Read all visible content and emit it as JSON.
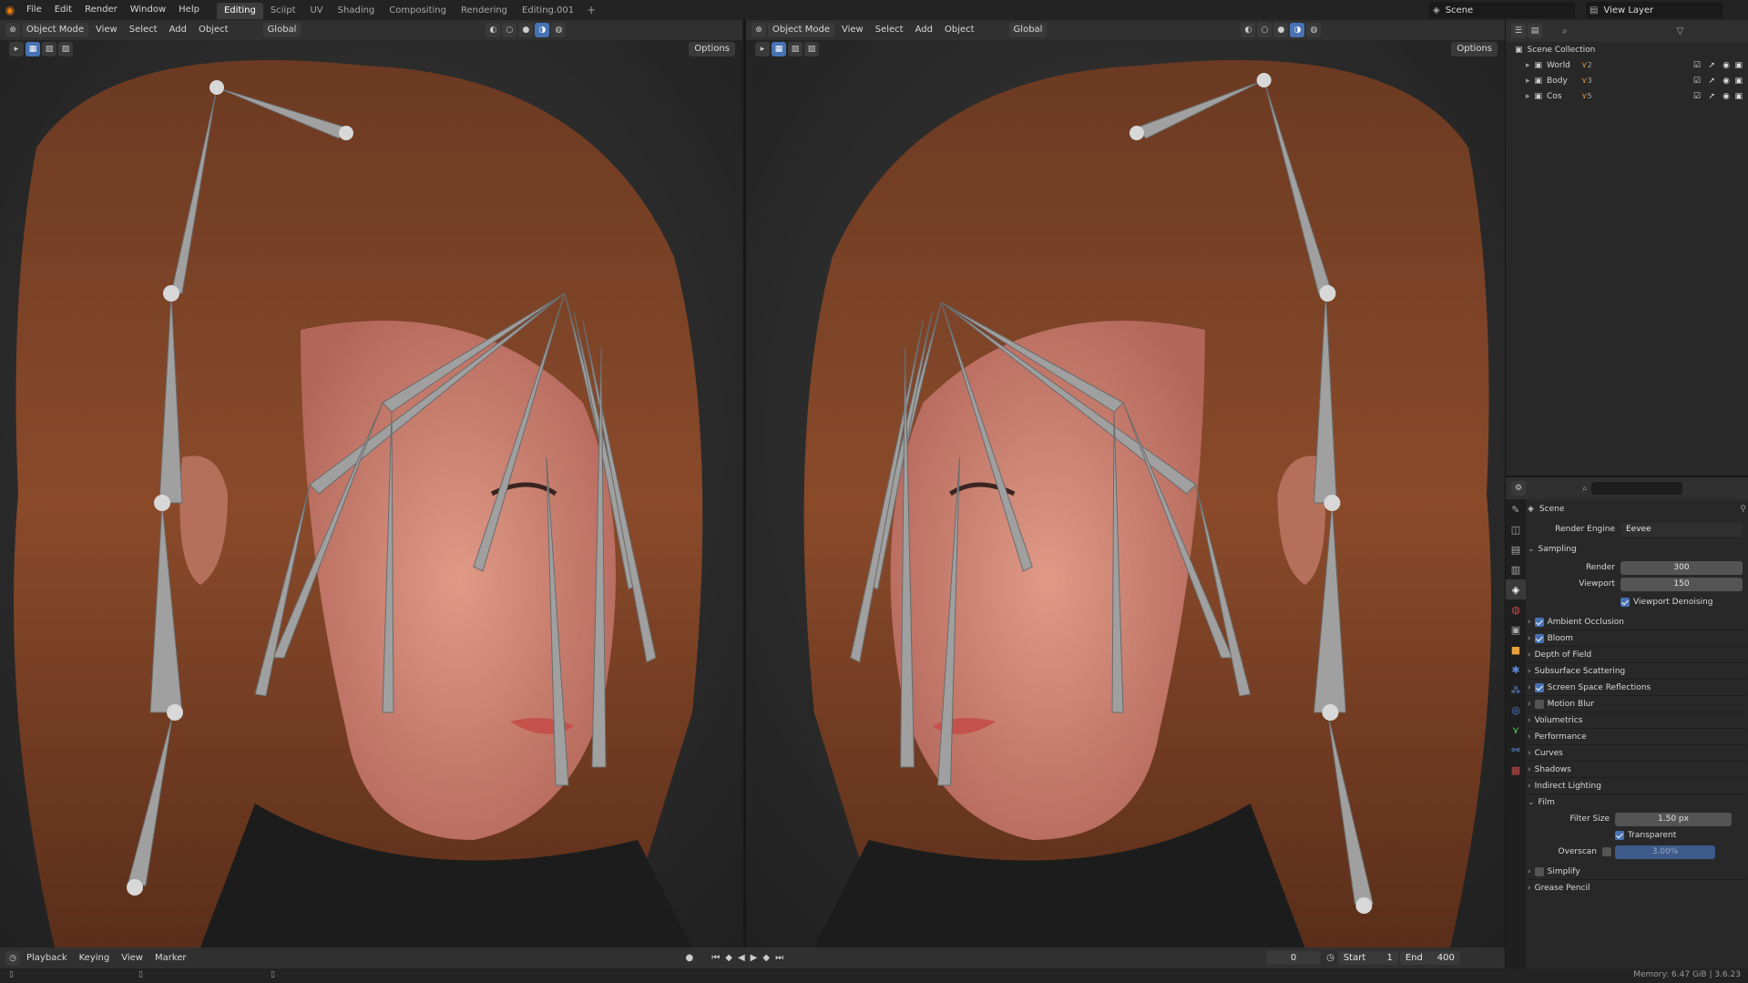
{
  "menus": [
    "File",
    "Edit",
    "Render",
    "Window",
    "Help"
  ],
  "workspaces": [
    {
      "label": "Editing",
      "active": true
    },
    {
      "label": "Sciipt",
      "active": false
    },
    {
      "label": "UV",
      "active": false
    },
    {
      "label": "Shading",
      "active": false
    },
    {
      "label": "Compositing",
      "active": false
    },
    {
      "label": "Rendering",
      "active": false
    },
    {
      "label": "Editing.001",
      "active": false
    }
  ],
  "scene_name": "Scene",
  "view_layer": "View Layer",
  "viewport": {
    "mode": "Object Mode",
    "menus": [
      "View",
      "Select",
      "Add",
      "Object"
    ],
    "transform": "Global",
    "options_label": "Options"
  },
  "outliner": {
    "collection": "Scene Collection",
    "items": [
      {
        "name": "World",
        "count": "2"
      },
      {
        "name": "Body",
        "count": "3"
      },
      {
        "name": "Cos",
        "count": "5"
      }
    ]
  },
  "properties": {
    "context": "Scene",
    "render_engine_label": "Render Engine",
    "render_engine": "Eevee",
    "sampling": {
      "header": "Sampling",
      "render_label": "Render",
      "render": "300",
      "viewport_label": "Viewport",
      "viewport": "150",
      "denoise": "Viewport Denoising"
    },
    "panels": [
      {
        "label": "Ambient Occlusion",
        "checkbox": true,
        "checked": true
      },
      {
        "label": "Bloom",
        "checkbox": true,
        "checked": true
      },
      {
        "label": "Depth of Field",
        "checkbox": false
      },
      {
        "label": "Subsurface Scattering",
        "checkbox": false
      },
      {
        "label": "Screen Space Reflections",
        "checkbox": true,
        "checked": true
      },
      {
        "label": "Motion Blur",
        "checkbox": true,
        "checked": false
      },
      {
        "label": "Volumetrics",
        "checkbox": false
      },
      {
        "label": "Performance",
        "checkbox": false
      },
      {
        "label": "Curves",
        "checkbox": false
      },
      {
        "label": "Shadows",
        "checkbox": false
      },
      {
        "label": "Indirect Lighting",
        "checkbox": false
      }
    ],
    "film": {
      "header": "Film",
      "filter_label": "Filter Size",
      "filter": "1.50 px",
      "transparent": "Transparent",
      "overscan_label": "Overscan",
      "overscan": "3.00%"
    },
    "after": [
      "Simplify",
      "Grease Pencil"
    ]
  },
  "timeline": {
    "menus": [
      "Playback",
      "Keying",
      "View",
      "Marker"
    ],
    "frame": "0",
    "start_label": "Start",
    "start": "1",
    "end_label": "End",
    "end": "400"
  },
  "status": {
    "memory": "Memory: 6.47 GiB | 3.6.23"
  },
  "colors": {
    "accent": "#4772b3",
    "brand": "#e87d0d",
    "bg": "#1d1d1d"
  }
}
